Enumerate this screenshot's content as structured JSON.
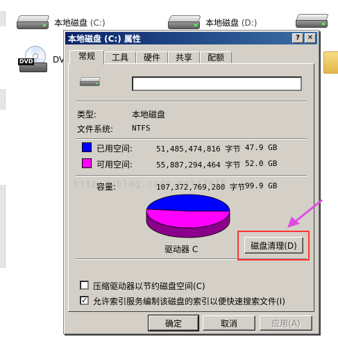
{
  "explorer": {
    "drive_c": {
      "name": "本地磁盘",
      "letter": "(C:)"
    },
    "drive_d": {
      "name": "本地磁盘",
      "letter": "(D:)"
    },
    "dvd": {
      "name": "DVD",
      "tag": "DVD"
    }
  },
  "dialog": {
    "title": "本地磁盘 (C:) 属性",
    "help_label": "?",
    "close_label": "✕",
    "tabs": [
      "常规",
      "工具",
      "硬件",
      "共享",
      "配额"
    ],
    "general": {
      "name_value": "",
      "type_label": "类型:",
      "type_value": "本地磁盘",
      "fs_label": "文件系统:",
      "fs_value": "NTFS",
      "used_label": "已用空间:",
      "used_bytes": "51,485,474,816 字节",
      "used_gb": "47.9 GB",
      "free_label": "可用空间:",
      "free_bytes": "55,887,294,464 字节",
      "free_gb": "52.0 GB",
      "capacity_label": "容量:",
      "capacity_bytes": "107,372,769,280 字节",
      "capacity_gb": "99.9 GB",
      "drive_label": "驱动器 C",
      "cleanup_button": "磁盘清理(D)",
      "compress_label": "压缩驱动器以节约磁盘空间(C)",
      "index_label": "允许索引服务编制该磁盘的索引以便快速搜索文件(I)",
      "compress_checked": false,
      "index_checked": true
    },
    "buttons": {
      "ok": "确定",
      "cancel": "取消",
      "apply": "应用(A)"
    }
  },
  "watermark": "http://blog.csdn.net/2016...",
  "colors": {
    "used": "#0000ff",
    "free": "#ff00ff",
    "highlight": "#ff3333",
    "arrow": "#e04be0"
  },
  "chart_data": {
    "type": "pie",
    "categories": [
      "已用空间",
      "可用空间"
    ],
    "values": [
      47.9,
      52.0
    ]
  }
}
